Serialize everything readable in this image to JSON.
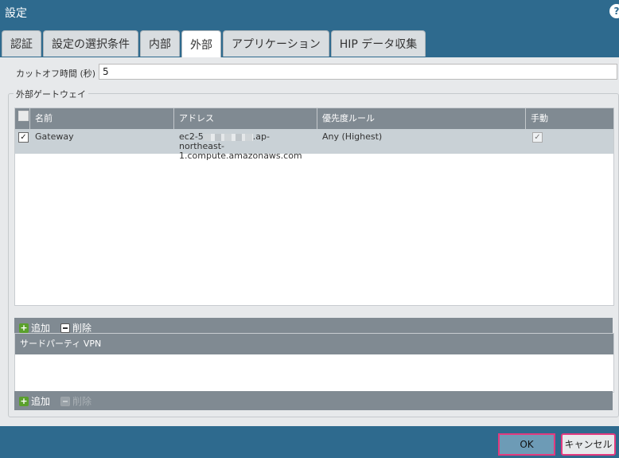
{
  "dialog": {
    "title": "設定",
    "help_icon": "help-icon"
  },
  "tabs": [
    {
      "label": "認証",
      "active": false
    },
    {
      "label": "設定の選択条件",
      "active": false
    },
    {
      "label": "内部",
      "active": false
    },
    {
      "label": "外部",
      "active": true
    },
    {
      "label": "アプリケーション",
      "active": false
    },
    {
      "label": "HIP データ収集",
      "active": false
    }
  ],
  "cutoff": {
    "label": "カットオフ時間 (秒)",
    "value": "5"
  },
  "external_gateways": {
    "legend": "外部ゲートウェイ",
    "columns": [
      "名前",
      "アドレス",
      "優先度ルール",
      "手動"
    ],
    "rows": [
      {
        "checked": true,
        "name": "Gateway",
        "address_prefix": "ec2-5",
        "address_suffix": ".ap-northeast-",
        "address_line2": "1.compute.amazonaws.com",
        "priority": "Any (Highest)",
        "manual": true
      }
    ],
    "toolbar": {
      "add": "追加",
      "delete": "削除"
    }
  },
  "third_party_vpn": {
    "header": "サードパーティ VPN",
    "toolbar": {
      "add": "追加",
      "delete": "削除"
    }
  },
  "footer": {
    "ok": "OK",
    "cancel": "キャンセル"
  },
  "colors": {
    "titlebar": "#2e6a8e",
    "grid_header": "#808a92",
    "selected_row": "#c9d1d6",
    "highlight": "#e23a7e"
  }
}
